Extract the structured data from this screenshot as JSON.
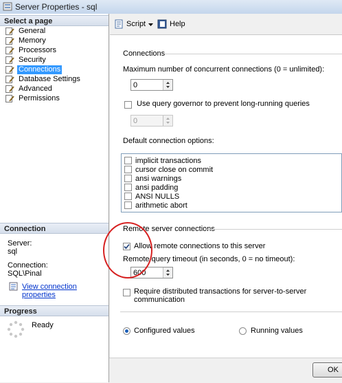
{
  "window": {
    "title": "Server Properties - sql"
  },
  "left": {
    "select_page_header": "Select a page",
    "pages": [
      {
        "label": "General"
      },
      {
        "label": "Memory"
      },
      {
        "label": "Processors"
      },
      {
        "label": "Security"
      },
      {
        "label": "Connections",
        "selected": true
      },
      {
        "label": "Database Settings"
      },
      {
        "label": "Advanced"
      },
      {
        "label": "Permissions"
      }
    ],
    "connection_header": "Connection",
    "server_label": "Server:",
    "server_value": "sql",
    "connection_label": "Connection:",
    "connection_value": "SQL\\Pinal",
    "view_props_link": "View connection properties",
    "progress_header": "Progress",
    "progress_status": "Ready"
  },
  "toolbar": {
    "script_label": "Script",
    "help_label": "Help"
  },
  "connections": {
    "header": "Connections",
    "max_conn_label": "Maximum number of concurrent connections (0 = unlimited):",
    "max_conn_value": "0",
    "query_governor_label": "Use query governor to prevent long-running queries",
    "query_governor_checked": false,
    "query_governor_value": "0",
    "default_options_label": "Default connection options:",
    "options": [
      {
        "label": "implicit transactions",
        "checked": false
      },
      {
        "label": "cursor close on commit",
        "checked": false
      },
      {
        "label": "ansi warnings",
        "checked": false
      },
      {
        "label": "ansi padding",
        "checked": false
      },
      {
        "label": "ANSI NULLS",
        "checked": false
      },
      {
        "label": "arithmetic abort",
        "checked": false
      }
    ]
  },
  "remote": {
    "header": "Remote server connections",
    "allow_label": "Allow remote connections to this server",
    "allow_checked": true,
    "timeout_label": "Remote query timeout (in seconds, 0 = no timeout):",
    "timeout_value": "600",
    "require_dist_label": "Require distributed transactions for server-to-server communication",
    "require_dist_checked": false
  },
  "values_mode": {
    "configured_label": "Configured values",
    "running_label": "Running values",
    "selected": "configured"
  },
  "buttons": {
    "ok_label": "OK"
  },
  "colors": {
    "selection": "#3399ff",
    "annotation": "#d62020",
    "link": "#0033cc"
  }
}
